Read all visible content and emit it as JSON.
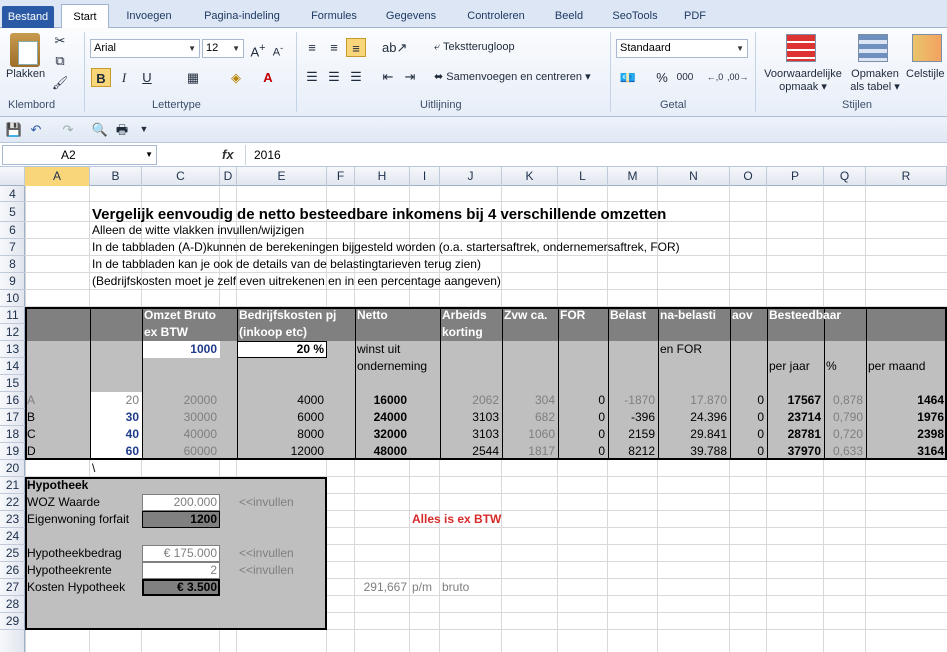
{
  "tabs": [
    "Bestand",
    "Start",
    "Invoegen",
    "Pagina-indeling",
    "Formules",
    "Gegevens",
    "Controleren",
    "Beeld",
    "SeoTools",
    "PDF"
  ],
  "ribbon": {
    "plakken": "Plakken",
    "klembord": "Klembord",
    "font": "Arial",
    "size": "12",
    "lettertype": "Lettertype",
    "bold": "B",
    "italic": "I",
    "underline": "U",
    "wrap": "Tekstterugloop",
    "merge": "Samenvoegen en centreren",
    "uitlijning": "Uitlijning",
    "numfmt": "Standaard",
    "getal": "Getal",
    "pct": "%",
    "thousands": "000",
    "cond1": "Voorwaardelijke",
    "cond2": "opmaak",
    "table1": "Opmaken",
    "table2": "als tabel",
    "cellstyle": "Celstijle",
    "stijlen": "Stijlen"
  },
  "formula": {
    "cell": "A2",
    "fx": "fx",
    "value": "2016"
  },
  "columns": [
    "A",
    "B",
    "C",
    "D",
    "E",
    "F",
    "H",
    "I",
    "J",
    "K",
    "L",
    "M",
    "N",
    "O",
    "P",
    "Q",
    "R"
  ],
  "rows": [
    "4",
    "5",
    "6",
    "7",
    "8",
    "9",
    "10",
    "11",
    "12",
    "13",
    "14",
    "15",
    "16",
    "17",
    "18",
    "19",
    "20",
    "21",
    "22",
    "23",
    "24",
    "25",
    "26",
    "27",
    "28",
    "29"
  ],
  "sheet": {
    "title": "Vergelijk eenvoudig de netto besteedbare inkomens bij 4 verschillende omzetten",
    "lines": [
      "Alleen de witte vlakken invullen/wijzigen",
      "In de tabbladen (A-D)kunnen de berekeningen bijgesteld worden (o.a. startersaftrek, ondernemersaftrek, FOR)",
      "In de tabbladen kan je ook de details van de belastingtarieven terug zien)",
      "(Bedrijfskosten moet je zelf even uitrekenen en in een percentage aangeven)"
    ],
    "h": {
      "omzet1": "Omzet Bruto",
      "omzet2": "ex BTW",
      "bk1": "Bedrijfskosten pj",
      "bk2": "(inkoop etc)",
      "netto": "Netto",
      "ak1": "Arbeids",
      "ak2": "korting",
      "zvw": "Zvw ca.",
      "for": "FOR",
      "belast": "Belast",
      "nab": "na-belasti",
      "aov": "aov",
      "best": "Besteedbaar"
    },
    "r13": {
      "c": "1000",
      "e": "20 %",
      "h": "winst uit",
      "n": "en FOR"
    },
    "r14": {
      "h": "onderneming",
      "p": "per jaar",
      "q": "%",
      "r": "per maand"
    },
    "data": [
      {
        "a": "A",
        "b": "20",
        "c": "20000",
        "e": "4000",
        "h": "16000",
        "j": "2062",
        "k": "304",
        "l": "0",
        "m": "-1870",
        "n": "17.870",
        "o": "0",
        "p": "17567",
        "q": "0,878",
        "r": "1464"
      },
      {
        "a": "B",
        "b": "30",
        "c": "30000",
        "e": "6000",
        "h": "24000",
        "j": "3103",
        "k": "682",
        "l": "0",
        "m": "-396",
        "n": "24.396",
        "o": "0",
        "p": "23714",
        "q": "0,790",
        "r": "1976"
      },
      {
        "a": "C",
        "b": "40",
        "c": "40000",
        "e": "8000",
        "h": "32000",
        "j": "3103",
        "k": "1060",
        "l": "0",
        "m": "2159",
        "n": "29.841",
        "o": "0",
        "p": "28781",
        "q": "0,720",
        "r": "2398"
      },
      {
        "a": "D",
        "b": "60",
        "c": "60000",
        "e": "12000",
        "h": "48000",
        "j": "2544",
        "k": "1817",
        "l": "0",
        "m": "8212",
        "n": "39.788",
        "o": "0",
        "p": "37970",
        "q": "0,633",
        "r": "3164"
      }
    ],
    "r20b": "\\",
    "hyp": {
      "title": "Hypotheek",
      "woz": "WOZ Waarde",
      "wozv": "200.000",
      "inv": "<<invullen",
      "ew": "Eigenwoning forfait",
      "ewv": "1200",
      "hb": "Hypotheekbedrag",
      "hbv": "€ 175.000",
      "hr": "Hypotheekrente",
      "hrv": "2",
      "kh": "Kosten Hypotheek",
      "khv": "€ 3.500"
    },
    "btw": "Alles is ex BTW",
    "pm": "291,667",
    "pml": "p/m",
    "bruto": "bruto"
  }
}
